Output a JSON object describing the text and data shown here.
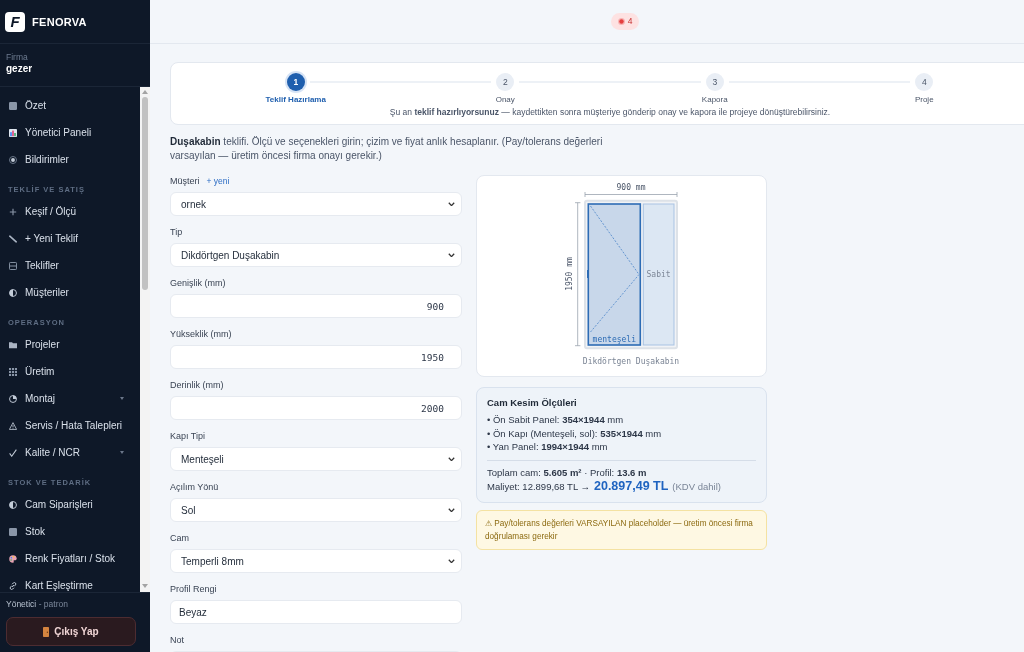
{
  "sidebar": {
    "brand": {
      "mark": "F",
      "name": "FENORVA"
    },
    "company": {
      "label": "Firma",
      "value": "gezer"
    },
    "nav": [
      {
        "kind": "item",
        "label": "Özet",
        "selected": false,
        "expandable": false
      },
      {
        "kind": "item",
        "label": "Yönetici Paneli",
        "selected": false,
        "expandable": false
      },
      {
        "kind": "item",
        "label": "Bildirimler",
        "selected": false,
        "expandable": false
      },
      {
        "kind": "section",
        "label": "TEKLİF VE SATIŞ"
      },
      {
        "kind": "item",
        "label": "Keşif / Ölçü",
        "selected": false,
        "expandable": false
      },
      {
        "kind": "item",
        "label": "+ Yeni Teklif",
        "selected": false,
        "expandable": false
      },
      {
        "kind": "item",
        "label": "Teklifler",
        "selected": false,
        "expandable": false
      },
      {
        "kind": "item",
        "label": "Müşteriler",
        "selected": false,
        "expandable": false
      },
      {
        "kind": "section",
        "label": "OPERASYON"
      },
      {
        "kind": "item",
        "label": "Projeler",
        "selected": false,
        "expandable": false
      },
      {
        "kind": "item",
        "label": "Üretim",
        "selected": false,
        "expandable": false
      },
      {
        "kind": "item",
        "label": "Montaj",
        "selected": false,
        "expandable": true
      },
      {
        "kind": "item",
        "label": "Servis / Hata Talepleri",
        "selected": false,
        "expandable": false
      },
      {
        "kind": "item",
        "label": "Kalite / NCR",
        "selected": false,
        "expandable": true
      },
      {
        "kind": "section",
        "label": "STOK VE TEDARİK"
      },
      {
        "kind": "item",
        "label": "Cam Siparişleri",
        "selected": false,
        "expandable": false
      },
      {
        "kind": "item",
        "label": "Stok",
        "selected": false,
        "expandable": false
      },
      {
        "kind": "item",
        "label": "Renk Fiyatları / Stok",
        "selected": false,
        "expandable": false
      },
      {
        "kind": "item",
        "label": "Kart Eşleştirme",
        "selected": false,
        "expandable": false
      }
    ],
    "user": {
      "role": "Yönetici",
      "name": "- patron"
    },
    "logout": "Çıkış Yap"
  },
  "topbar": {
    "notifications": "4"
  },
  "stepper": {
    "steps": [
      {
        "number": "1",
        "label": "Teklif Hazırlama",
        "selected": true
      },
      {
        "number": "2",
        "label": "Onay",
        "selected": false
      },
      {
        "number": "3",
        "label": "Kapora",
        "selected": false
      },
      {
        "number": "4",
        "label": "Proje",
        "selected": false
      }
    ],
    "note": "Şu an **teklif hazırlıyorsunuz** — kaydettikten sonra müşteriye gönderip onay ve kapora ile projeye dönüştürebilirsiniz."
  },
  "intro": "**Duşakabin** teklifi. Ölçü ve seçenekleri girin; çizim ve fiyat anlık hesaplanır. (Pay/tolerans değerleri varsayılan — üretim öncesi firma onayı gerekir.)",
  "form": {
    "fields": [
      {
        "kind": "select",
        "label": "Müşteri",
        "link": "+ yeni",
        "value": "ornek"
      },
      {
        "kind": "select",
        "label": "Tip",
        "value": "Dikdörtgen Duşakabin"
      },
      {
        "kind": "number",
        "label": "Genişlik (mm)",
        "value": "900"
      },
      {
        "kind": "number",
        "label": "Yükseklik (mm)",
        "value": "1950"
      },
      {
        "kind": "number",
        "label": "Derinlik (mm)",
        "value": "2000"
      },
      {
        "kind": "select",
        "label": "Kapı Tipi",
        "value": "Menteşeli"
      },
      {
        "kind": "select",
        "label": "Açılım Yönü",
        "value": "Sol"
      },
      {
        "kind": "select",
        "label": "Cam",
        "value": "Temperli 8mm"
      },
      {
        "kind": "text",
        "label": "Profil Rengi",
        "value": "Beyaz"
      },
      {
        "kind": "textarea",
        "label": "Not"
      }
    ]
  },
  "drawing": {
    "width_label": "900 mm",
    "height_label": "1950 mm",
    "door_label": "menteşeli",
    "fixed_label": "Sabit",
    "caption": "Dikdörtgen Duşakabin"
  },
  "cut_list": {
    "title": "Cam Kesim Ölçüleri",
    "items": [
      "• Ön Sabit Panel: **354×1944** mm",
      "• Ön Kapı (Menteşeli, sol): **535×1944** mm",
      "• Yan Panel: **1994×1944** mm"
    ],
    "totals": "Toplam cam: **5.605 m²** · Profil: **13.6 m**",
    "cost": "Maliyet: 12.899,68 TL →",
    "total": "20.897,49 TL",
    "vat_note": "(KDV dahil)"
  },
  "warning": "⚠ Pay/tolerans değerleri VARSAYILAN placeholder — üretim öncesi firma doğrulaması gerekir"
}
